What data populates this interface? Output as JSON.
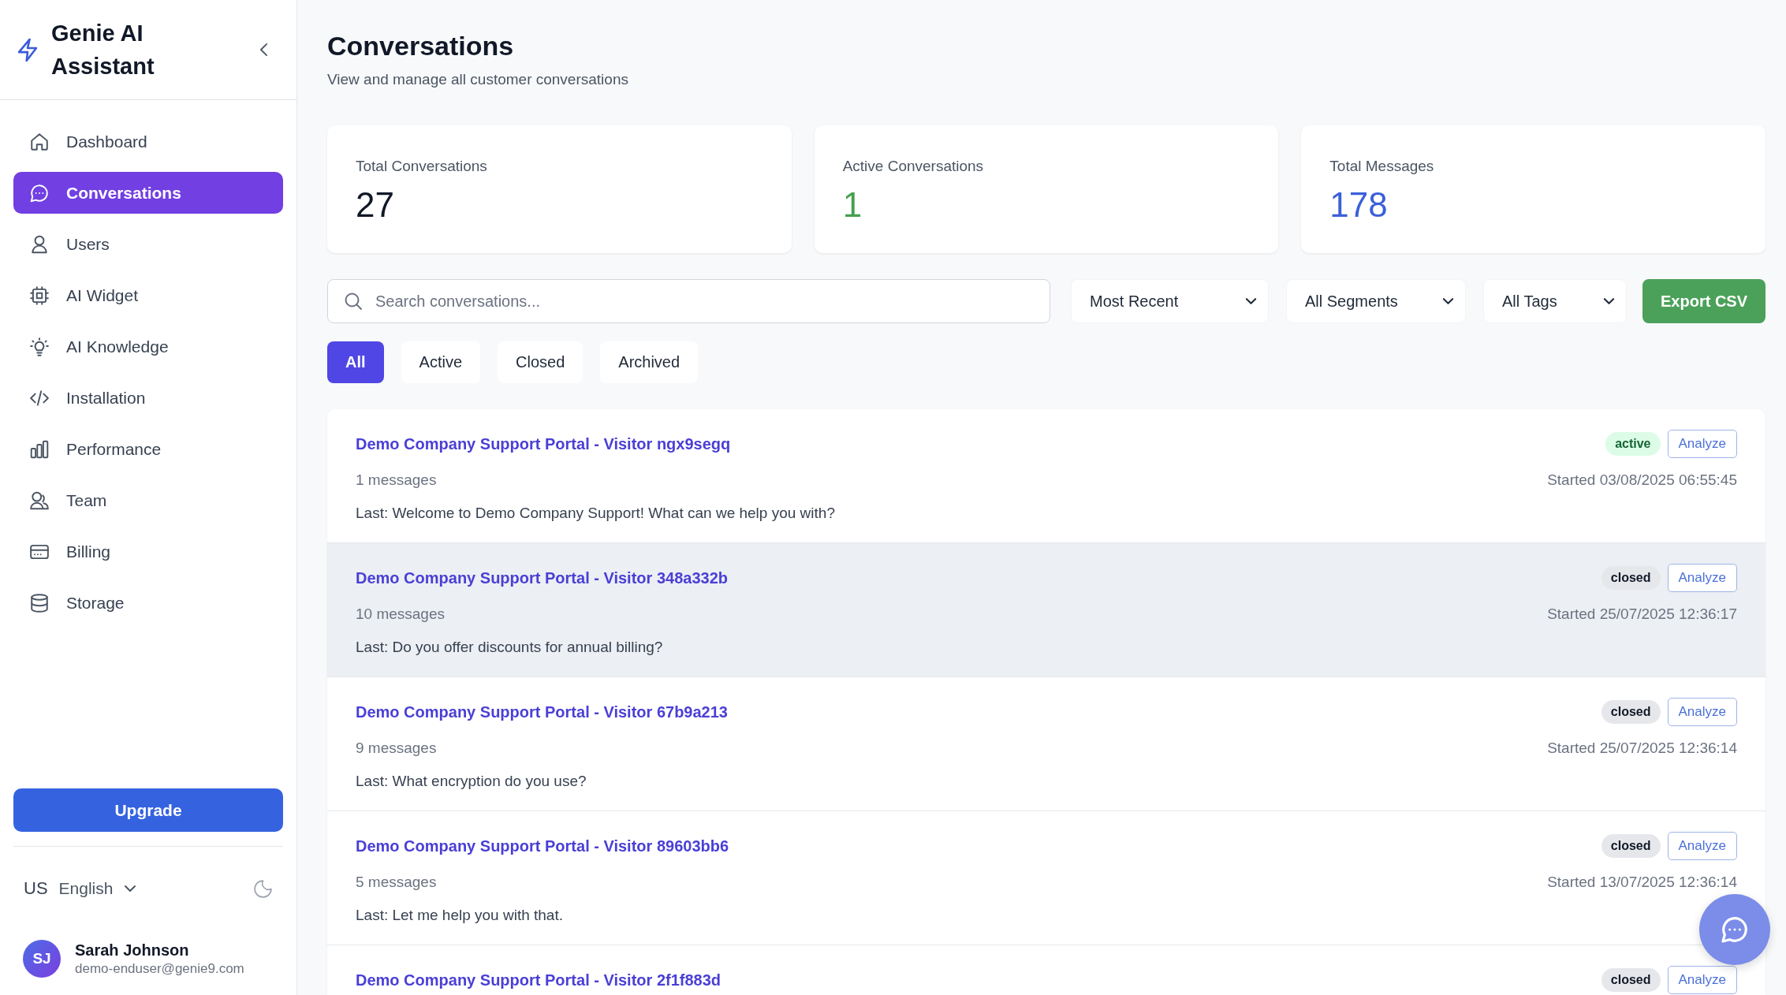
{
  "sidebar": {
    "brand": "Genie AI Assistant",
    "items": [
      {
        "label": "Dashboard",
        "selected": false
      },
      {
        "label": "Conversations",
        "selected": true
      },
      {
        "label": "Users",
        "selected": false
      },
      {
        "label": "AI Widget",
        "selected": false
      },
      {
        "label": "AI Knowledge",
        "selected": false
      },
      {
        "label": "Installation",
        "selected": false
      },
      {
        "label": "Performance",
        "selected": false
      },
      {
        "label": "Team",
        "selected": false
      },
      {
        "label": "Billing",
        "selected": false
      },
      {
        "label": "Storage",
        "selected": false
      }
    ],
    "upgrade_button": "Upgrade",
    "language": {
      "country": "US",
      "label": "English"
    },
    "user": {
      "initials": "SJ",
      "name": "Sarah Johnson",
      "email": "demo-enduser@genie9.com"
    }
  },
  "header": {
    "title": "Conversations",
    "subtitle": "View and manage all customer conversations"
  },
  "stats": [
    {
      "label": "Total Conversations",
      "value": "27",
      "color": "#111827"
    },
    {
      "label": "Active Conversations",
      "value": "1",
      "color": "#45a04f"
    },
    {
      "label": "Total Messages",
      "value": "178",
      "color": "#3b60d8"
    }
  ],
  "toolbar": {
    "search": {
      "placeholder": "Search conversations..."
    },
    "dropdowns": [
      "Most Recent",
      "All Segments",
      "All Tags"
    ],
    "export_button": "Export CSV"
  },
  "tabs": [
    {
      "label": "All",
      "selected": true
    },
    {
      "label": "Active",
      "selected": false
    },
    {
      "label": "Closed",
      "selected": false
    },
    {
      "label": "Archived",
      "selected": false
    }
  ],
  "conversations": [
    {
      "title": "Demo Company Support Portal - Visitor ngx9segq",
      "status": {
        "text": "active",
        "kind": "success"
      },
      "action": "Analyze",
      "messages": "1 messages",
      "started": "Started 03/08/2025 06:55:45",
      "last": "Last: Welcome to Demo Company Support! What can we help you with?",
      "highlighted": false
    },
    {
      "title": "Demo Company Support Portal - Visitor 348a332b",
      "status": {
        "text": "closed",
        "kind": "neutral"
      },
      "action": "Analyze",
      "messages": "10 messages",
      "started": "Started 25/07/2025 12:36:17",
      "last": "Last: Do you offer discounts for annual billing?",
      "highlighted": true
    },
    {
      "title": "Demo Company Support Portal - Visitor 67b9a213",
      "status": {
        "text": "closed",
        "kind": "neutral"
      },
      "action": "Analyze",
      "messages": "9 messages",
      "started": "Started 25/07/2025 12:36:14",
      "last": "Last: What encryption do you use?",
      "highlighted": false
    },
    {
      "title": "Demo Company Support Portal - Visitor 89603bb6",
      "status": {
        "text": "closed",
        "kind": "neutral"
      },
      "action": "Analyze",
      "messages": "5 messages",
      "started": "Started 13/07/2025 12:36:14",
      "last": "Last: Let me help you with that.",
      "highlighted": false
    },
    {
      "title": "Demo Company Support Portal - Visitor 2f1f883d",
      "status": {
        "text": "closed",
        "kind": "neutral"
      },
      "action": "Analyze",
      "highlighted": false
    }
  ]
}
